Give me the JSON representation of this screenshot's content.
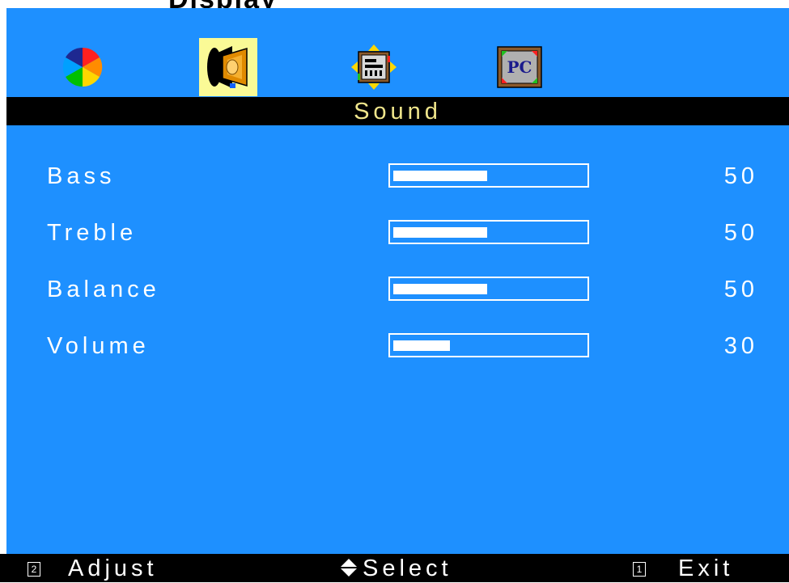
{
  "window": {
    "partial_title": "Display"
  },
  "tabs": [
    {
      "name": "color",
      "icon": "color-wheel-icon",
      "selected": false
    },
    {
      "name": "sound",
      "icon": "speaker-icon",
      "selected": true
    },
    {
      "name": "display",
      "icon": "position-screen-icon",
      "selected": false
    },
    {
      "name": "pc",
      "icon": "pc-monitor-icon",
      "selected": false
    }
  ],
  "menu": {
    "title": "Sound",
    "items": [
      {
        "label": "Bass",
        "value": "50",
        "level": 0.5
      },
      {
        "label": "Treble",
        "value": "50",
        "level": 0.5
      },
      {
        "label": "Balance",
        "value": "50",
        "level": 0.5
      },
      {
        "label": "Volume",
        "value": "30",
        "level": 0.3
      }
    ]
  },
  "footer": {
    "adjust_key": "2",
    "adjust_label": "Adjust",
    "select_glyph": "up-down-arrows-icon",
    "select_label": "Select",
    "exit_key": "1",
    "exit_label": "Exit"
  },
  "colors": {
    "panel": "#1e90ff",
    "title_text": "#f0e68c",
    "selected_tab": "#fafa96",
    "bar": "#ffffff"
  }
}
